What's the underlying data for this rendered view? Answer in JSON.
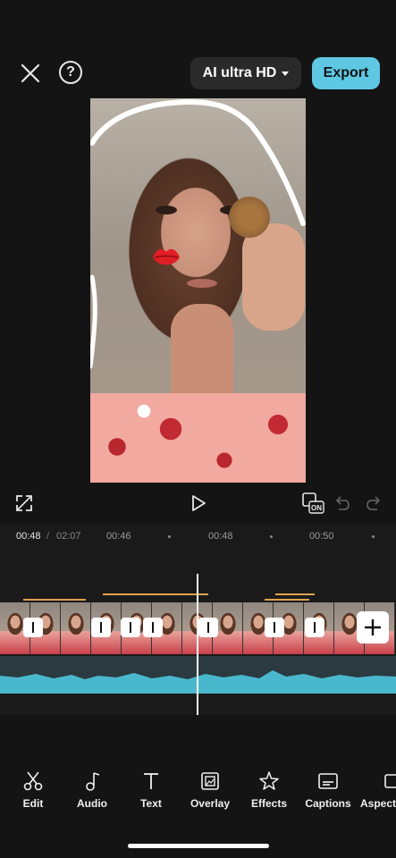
{
  "header": {
    "quality_label": "AI ultra HD",
    "export_label": "Export"
  },
  "icons": {
    "close": "close-icon",
    "help": "help-icon",
    "help_glyph": "?",
    "fullscreen": "fullscreen-icon",
    "play": "play-icon",
    "keyframe": "keyframe-on-icon",
    "keyframe_badge": "ON",
    "undo": "undo-icon",
    "redo": "redo-icon",
    "add": "plus-icon"
  },
  "timeline": {
    "current_time": "00:48",
    "separator": "/",
    "total_time": "02:07",
    "ruler": [
      "00:46",
      "00:48",
      "00:50"
    ]
  },
  "toolbar": {
    "items": [
      {
        "label": "Edit",
        "icon": "scissors-icon"
      },
      {
        "label": "Audio",
        "icon": "music-note-icon"
      },
      {
        "label": "Text",
        "icon": "text-icon"
      },
      {
        "label": "Overlay",
        "icon": "overlay-icon"
      },
      {
        "label": "Effects",
        "icon": "sparkle-icon"
      },
      {
        "label": "Captions",
        "icon": "captions-icon"
      },
      {
        "label": "Aspect",
        "icon": "aspect-icon"
      }
    ]
  },
  "colors": {
    "accent": "#5ec8e3",
    "background": "#141414",
    "audio_wave": "#4ab8cc",
    "effect_line": "#e0a24a"
  }
}
